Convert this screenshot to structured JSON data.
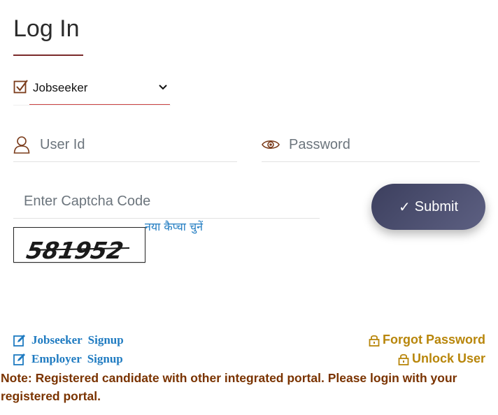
{
  "page": {
    "title": "Log In"
  },
  "role_select": {
    "selected": "Jobseeker",
    "options": [
      "Jobseeker"
    ]
  },
  "form": {
    "userid_placeholder": "User Id",
    "password_placeholder": "Password",
    "captcha_placeholder": "Enter Captcha Code",
    "submit_label": "Submit",
    "submit_check": "✓"
  },
  "captcha": {
    "code": "581952",
    "refresh_label": "नया कैप्चा चुनें"
  },
  "links": {
    "jobseeker_signup": "Jobseeker  Signup",
    "employer_signup": "Employer  Signup",
    "forgot_password": "Forgot Password",
    "unlock_user": "Unlock User"
  },
  "note": "Note: Registered candidate with other integrated portal. Please login with your registered portal.",
  "colors": {
    "link_blue": "#1f7bc1",
    "gold": "#b8860b",
    "note_brown": "#7a3300",
    "accent_red": "#7a2a2a",
    "button_dark": "#3c3f5e"
  }
}
